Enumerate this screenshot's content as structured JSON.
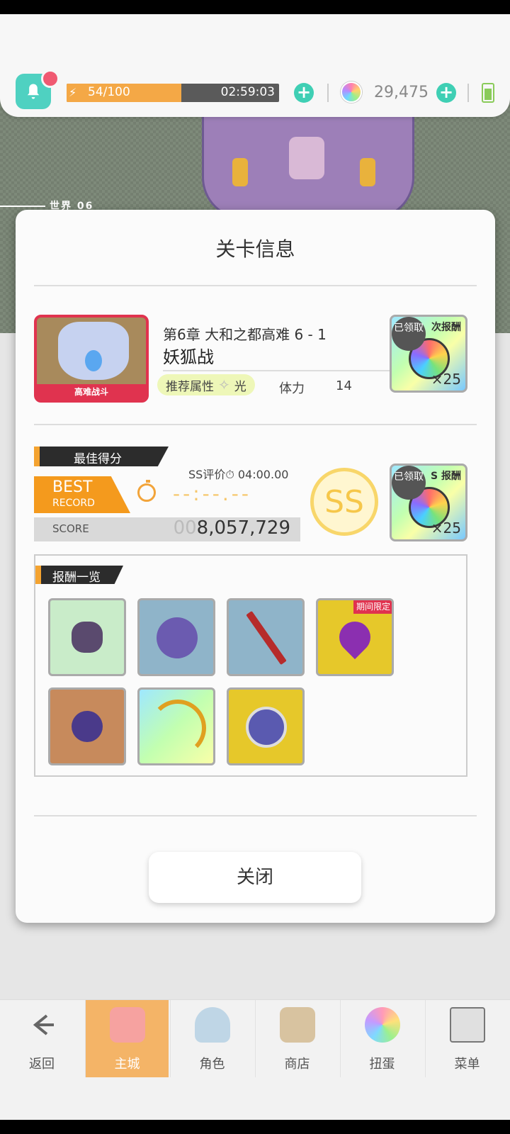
{
  "status": {
    "stamina_count": "54/100",
    "stamina_fill": 0.54,
    "stamina_timer": "02:59:03",
    "gem_count": "29,475"
  },
  "background": {
    "world_label": "世界  06"
  },
  "dialog": {
    "title": "关卡信息",
    "stage": {
      "thumb_label": "高难战斗",
      "chapter": "第6章 大和之都高难 6 - 1",
      "name": "妖狐战",
      "attr_label": "推荐属性",
      "attr_value": "光",
      "stamina_label": "体力",
      "stamina_value": "14",
      "first_reward": {
        "ribbon": "次报酬",
        "badge": "已领取",
        "qty": "×25"
      }
    },
    "best": {
      "tag": "最佳得分",
      "ss_time": "SS评价⏱ 04:00.00",
      "record_line1": "BEST",
      "record_line2": "RECORD",
      "time": "--:--.--",
      "score_label": "SCORE",
      "score_pad": "00",
      "score_value": "8,057,729",
      "medal": "SS",
      "ss_reward": {
        "ribbon": "S 报酬",
        "badge": "已领取",
        "qty": "×25"
      }
    },
    "rewards": {
      "tag": "报酬一览",
      "limited_label": "期间限定"
    },
    "close_label": "关闭"
  },
  "nav": [
    {
      "label": "返回",
      "icon": "back-arrow-icon"
    },
    {
      "label": "主城",
      "icon": "castle-icon"
    },
    {
      "label": "角色",
      "icon": "character-icon"
    },
    {
      "label": "商店",
      "icon": "shop-icon"
    },
    {
      "label": "扭蛋",
      "icon": "gacha-icon"
    },
    {
      "label": "菜单",
      "icon": "menu-list-icon"
    }
  ],
  "colors": {
    "accent": "#f4a330",
    "teal": "#3fcfb4",
    "limited": "#e0334f"
  }
}
